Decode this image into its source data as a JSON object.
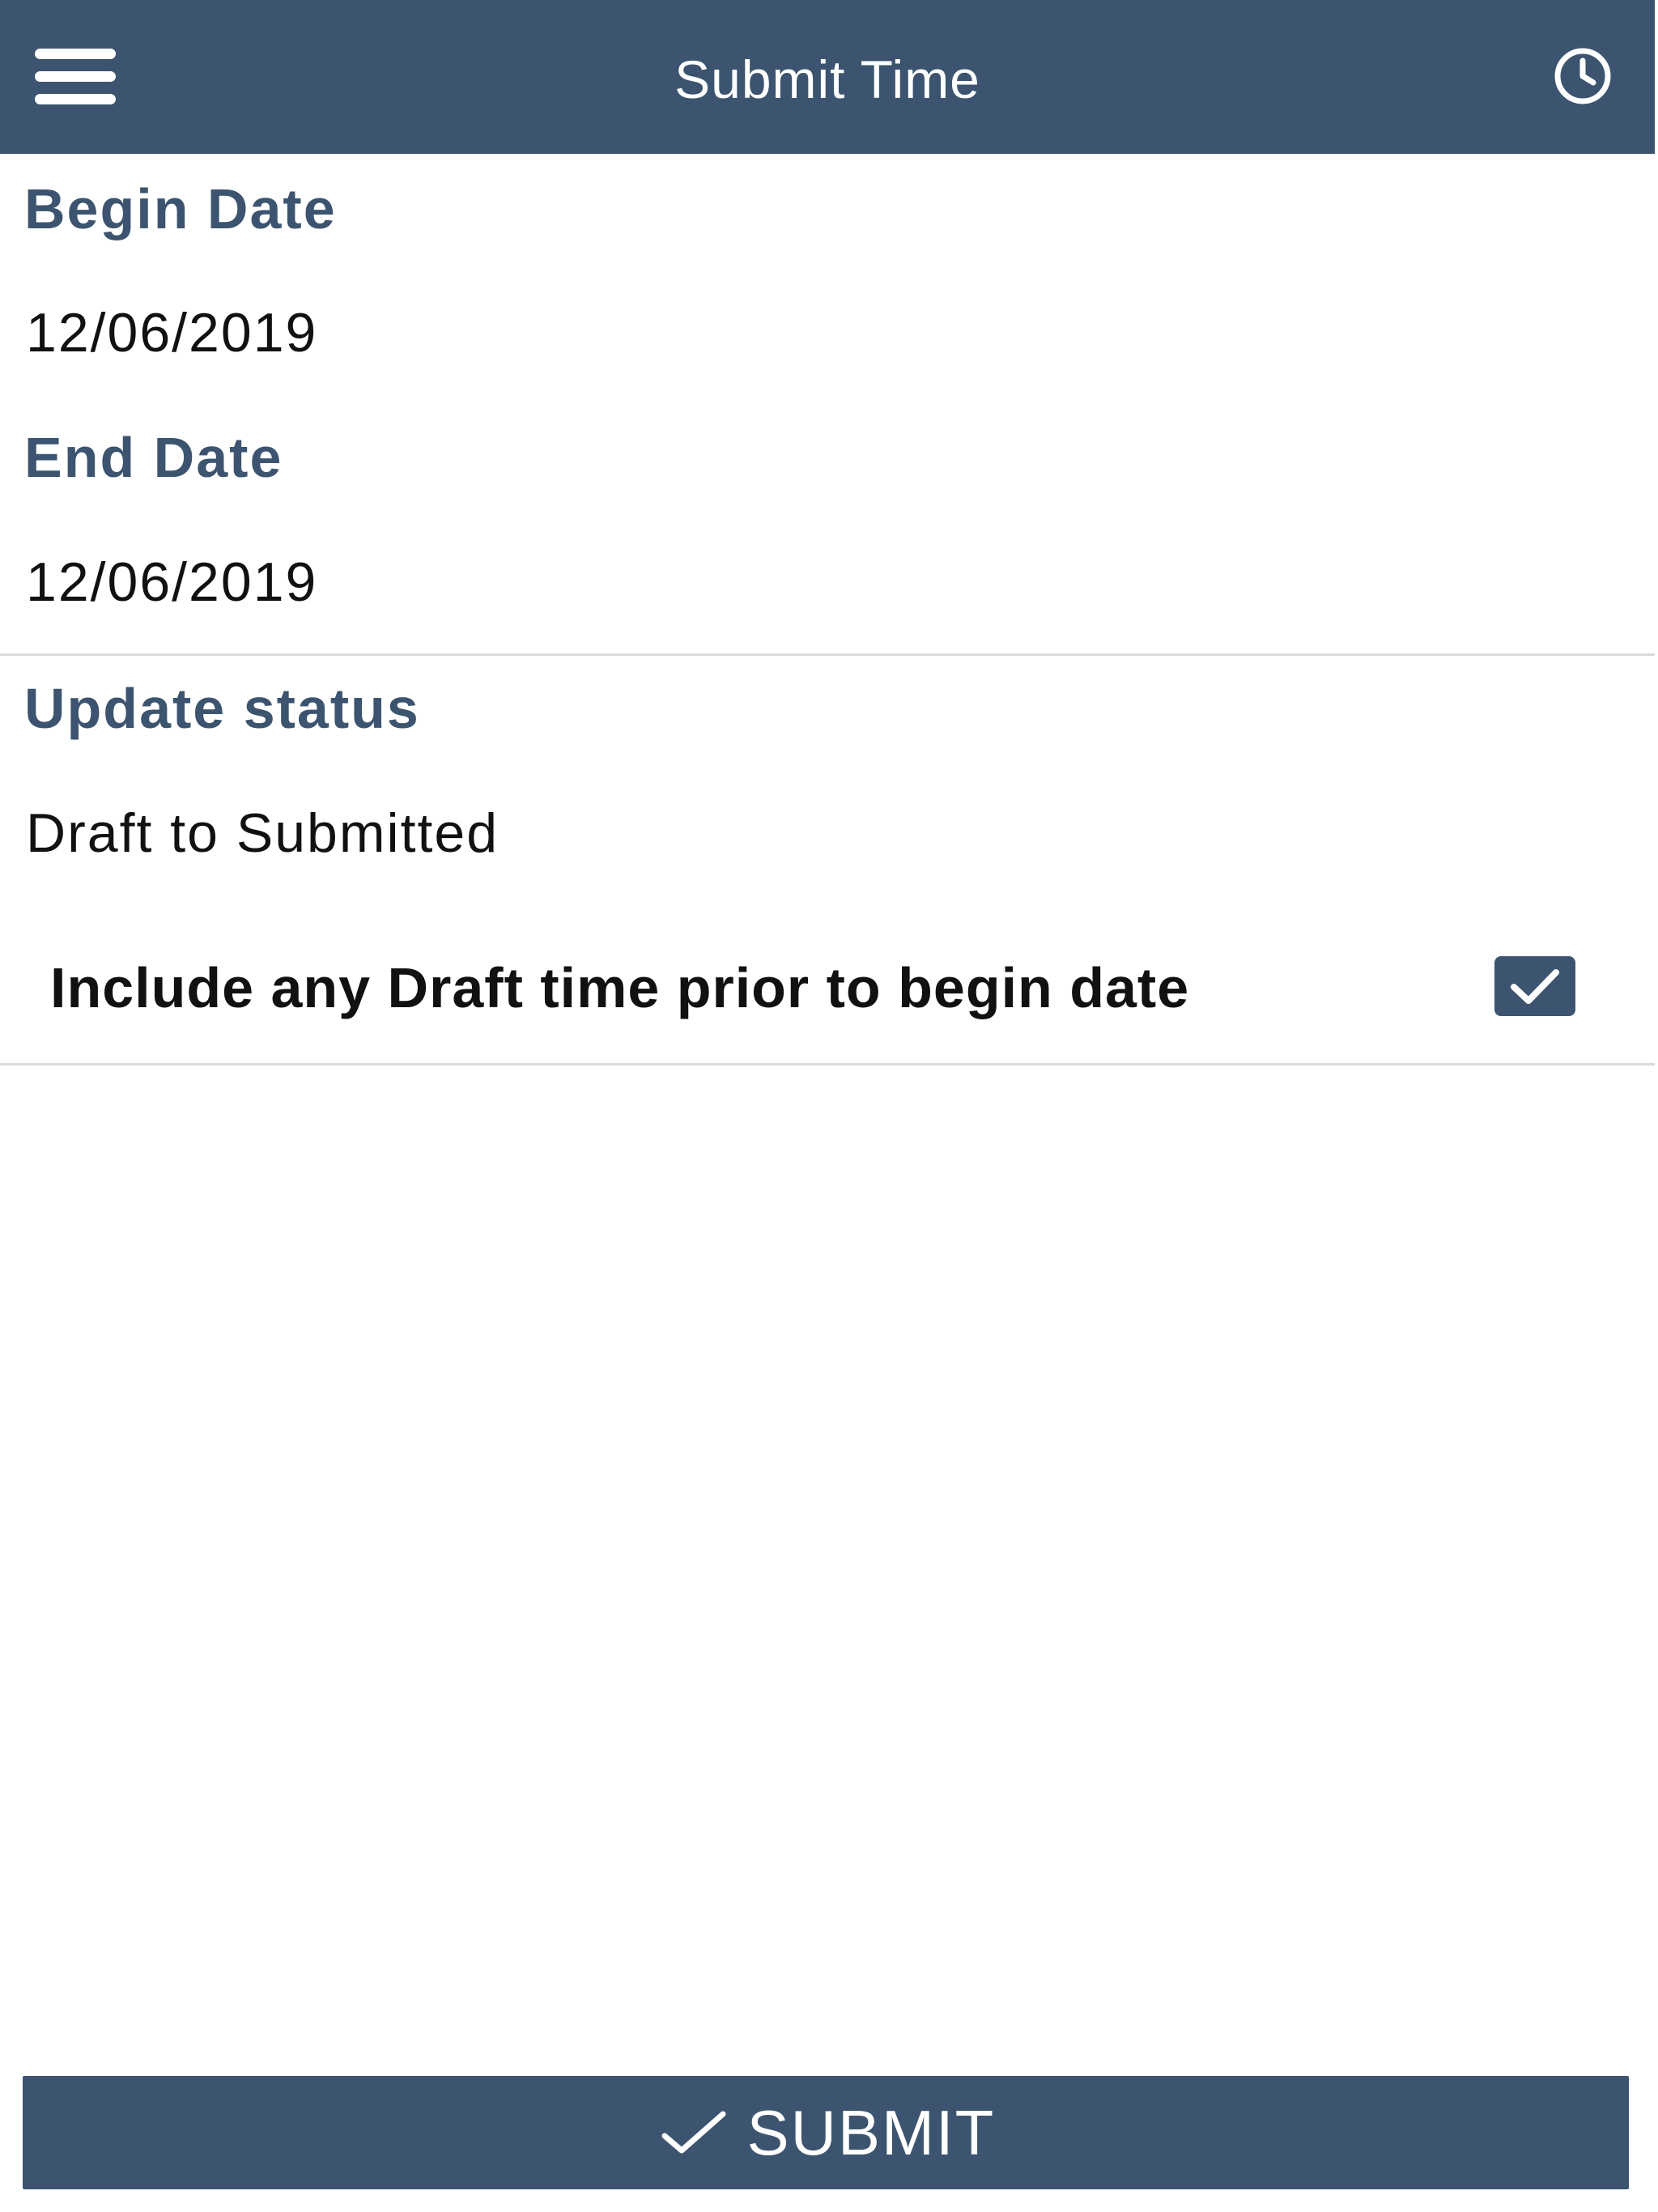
{
  "header": {
    "title": "Submit Time",
    "menu_icon": "hamburger-menu-icon",
    "history_icon": "clock-icon"
  },
  "form": {
    "begin_date": {
      "label": "Begin Date",
      "value": "12/06/2019"
    },
    "end_date": {
      "label": "End Date",
      "value": "12/06/2019"
    },
    "update_status": {
      "label": "Update status",
      "value": "Draft to Submitted"
    },
    "include_prior_draft": {
      "label": "Include any Draft time prior to begin date",
      "checked": true
    }
  },
  "footer": {
    "submit_label": "SUBMIT",
    "submit_icon": "check-icon"
  },
  "colors": {
    "primary": "#3c546f",
    "divider": "#dadada",
    "text": "#111111",
    "background": "#ffffff"
  }
}
